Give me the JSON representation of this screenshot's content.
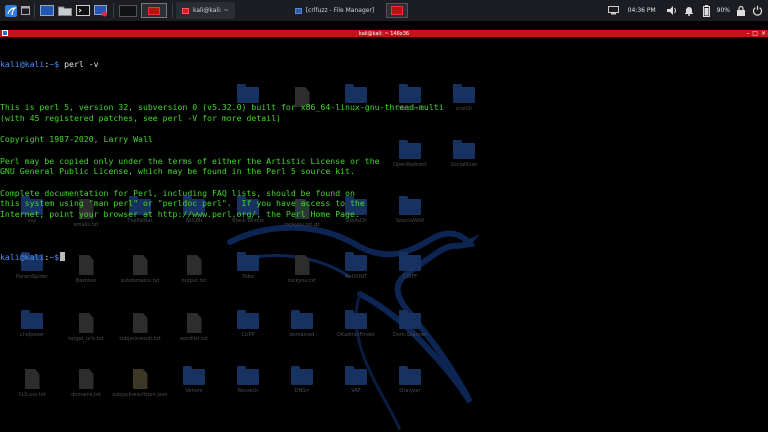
{
  "panel": {
    "task_terminal": "kali@kali: ~",
    "task_file_manager": "[crlfuzz - File Manager]",
    "clock": "04:36 PM",
    "battery_percent": "90%",
    "icons": [
      "kali-menu-icon",
      "desktop-icon",
      "file-manager-icon",
      "terminal-icon",
      "browser-icon",
      "speaker-icon",
      "notifications-icon",
      "battery-icon",
      "lock-icon",
      "power-icon"
    ]
  },
  "terminal": {
    "window_title": "kali@kali: ~ 146x36",
    "prompt_user": "kali@kali",
    "prompt_sep": ":",
    "prompt_path": "~$",
    "command": " perl -v",
    "output": [
      "",
      "This is perl 5, version 32, subversion 0 (v5.32.0) built for x86_64-linux-gnu-thread-multi",
      "(with 45 registered patches, see perl -V for more detail)",
      "",
      "Copyright 1987-2020, Larry Wall",
      "",
      "Perl may be copied only under the terms of either the Artistic License or the",
      "GNU General Public License, which may be found in the Perl 5 source kit.",
      "",
      "Complete documentation for Perl, including FAQ lists, should be found on",
      "this system using \"man perl\" or \"perldoc perl\".  If you have access to the",
      "Internet, point your browser at http://www.perl.org/, the Perl Home Page.",
      ""
    ]
  },
  "desktop": {
    "icons": [
      {
        "label": "",
        "type": "folder"
      },
      {
        "label": "",
        "type": "file"
      },
      {
        "label": "",
        "type": "folder"
      },
      {
        "label": "ZAP_latest",
        "type": "folder"
      },
      {
        "label": "scanSr",
        "type": "folder"
      },
      {
        "label": "OpenRedirect",
        "type": "folder"
      },
      {
        "label": "SocialScan",
        "type": "folder"
      },
      {
        "label": "ssy",
        "type": "folder"
      },
      {
        "label": "emails.txt",
        "type": "file"
      },
      {
        "label": "TheFatRat",
        "type": "folder"
      },
      {
        "label": "NUUBI",
        "type": "folder"
      },
      {
        "label": "Black-Widow",
        "type": "folder"
      },
      {
        "label": "rockyou.txt.gz",
        "type": "gz"
      },
      {
        "label": "Sublist3r",
        "type": "folder"
      },
      {
        "label": "SourceWolf",
        "type": "folder"
      },
      {
        "label": "ParamSpider",
        "type": "folder"
      },
      {
        "label": "Bashtex",
        "type": "file"
      },
      {
        "label": "subdomains.txt",
        "type": "file"
      },
      {
        "label": "output.txt",
        "type": "file"
      },
      {
        "label": "Tobo",
        "type": "folder"
      },
      {
        "label": "rockyou.txt",
        "type": "file"
      },
      {
        "label": "AnOSINT",
        "type": "folder"
      },
      {
        "label": "CWFF",
        "type": "folder"
      },
      {
        "label": "cl-elpexer",
        "type": "folder"
      },
      {
        "label": "target_urls.txt",
        "type": "file"
      },
      {
        "label": "subjackresult.txt",
        "type": "file"
      },
      {
        "label": "wordlist.txt",
        "type": "file"
      },
      {
        "label": "CUPP",
        "type": "folder"
      },
      {
        "label": "domained",
        "type": "folder"
      },
      {
        "label": "OKadminFinder",
        "type": "folder"
      },
      {
        "label": "Dork-Scanner",
        "type": "folder"
      },
      {
        "label": "XLS.xss.txt",
        "type": "file"
      },
      {
        "label": "domains.txt",
        "type": "file"
      },
      {
        "label": "subjackresultjson.json",
        "type": "zip"
      },
      {
        "label": "Venom",
        "type": "folder"
      },
      {
        "label": "Recsech",
        "type": "folder"
      },
      {
        "label": "DNSrr",
        "type": "folder"
      },
      {
        "label": "VAF",
        "type": "folder"
      },
      {
        "label": "Oralyzer",
        "type": "folder"
      }
    ]
  }
}
